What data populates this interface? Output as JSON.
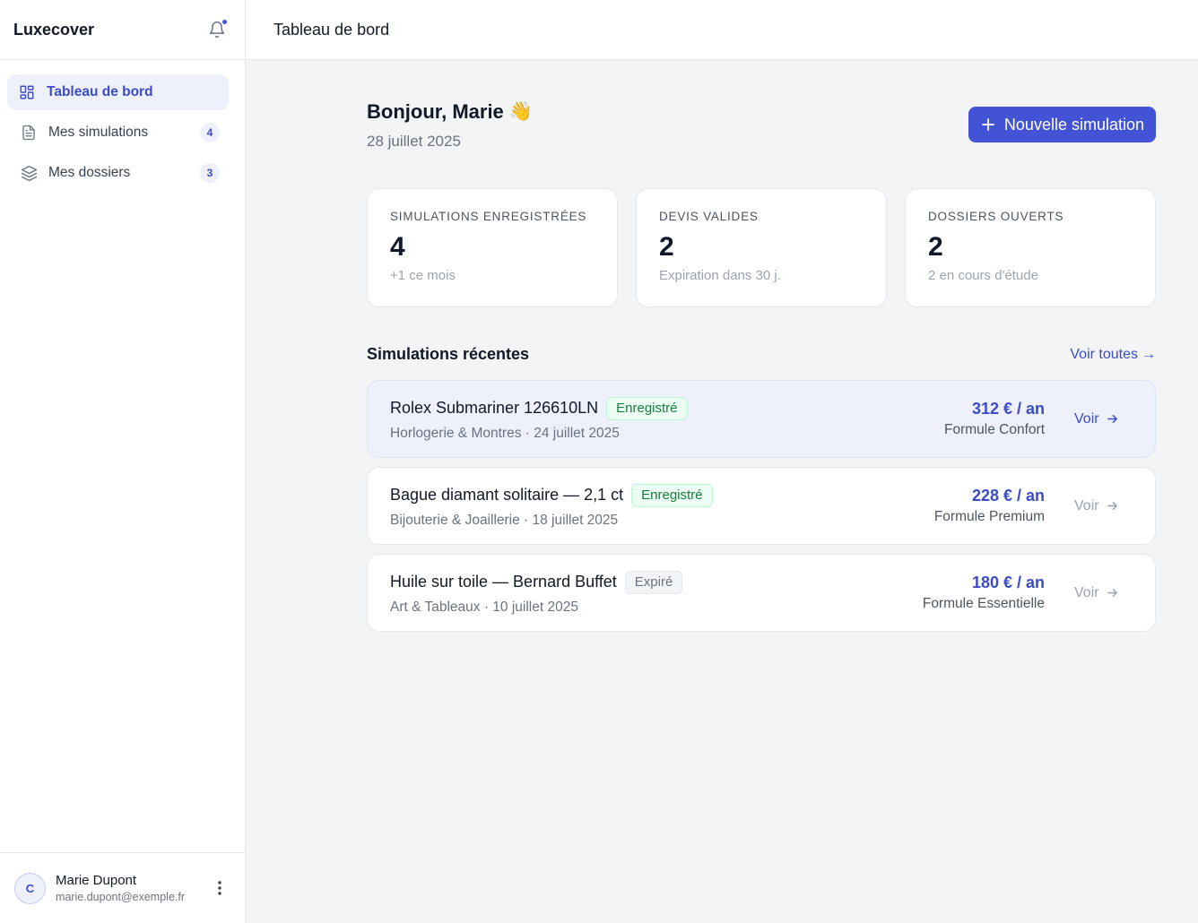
{
  "sidebar": {
    "brand": "Luxecover",
    "nav": [
      {
        "label": "Tableau de bord",
        "icon": "dashboard-grid-icon",
        "count": ""
      },
      {
        "label": "Mes simulations",
        "icon": "document-icon",
        "count": "4"
      },
      {
        "label": "Mes dossiers",
        "icon": "layers-icon",
        "count": "3"
      }
    ],
    "user": {
      "initial": "C",
      "name": "Marie Dupont",
      "email": "marie.dupont@exemple.fr"
    }
  },
  "topbar": {
    "title": "Tableau de bord"
  },
  "main": {
    "greeting": "Bonjour, Marie",
    "wave": "👋",
    "date": "28 juillet 2025",
    "new_button": "Nouvelle simulation",
    "stats": [
      {
        "label": "SIMULATIONS ENREGISTRÉES",
        "value": "4",
        "sub": "+1 ce mois"
      },
      {
        "label": "DEVIS VALIDES",
        "value": "2",
        "sub": "Expiration dans 30 j."
      },
      {
        "label": "DOSSIERS OUVERTS",
        "value": "2",
        "sub": "2 en cours d'étude"
      }
    ],
    "recent_title": "Simulations récentes",
    "see_all": "Voir toutes",
    "see_all_arrow": "→",
    "simulations": [
      {
        "title": "Rolex Submariner 126610LN",
        "status": "Enregistré",
        "meta": "Horlogerie & Montres · 24 juillet 2025",
        "price": "312 € / an",
        "formula": "Formule Confort",
        "action": "Voir"
      },
      {
        "title": "Bague diamant solitaire — 2,1 ct",
        "status": "Enregistré",
        "meta": "Bijouterie & Joaillerie · 18 juillet 2025",
        "price": "228 € / an",
        "formula": "Formule Premium",
        "action": "Voir"
      },
      {
        "title": "Huile sur toile — Bernard Buffet",
        "status": "Expiré",
        "meta": "Art & Tableaux · 10 juillet 2025",
        "price": "180 € / an",
        "formula": "Formule Essentielle",
        "action": "Voir"
      }
    ]
  },
  "colors": {
    "accent": "#4353d6",
    "active_bg": "#eef0fc",
    "success": "#15803d"
  }
}
